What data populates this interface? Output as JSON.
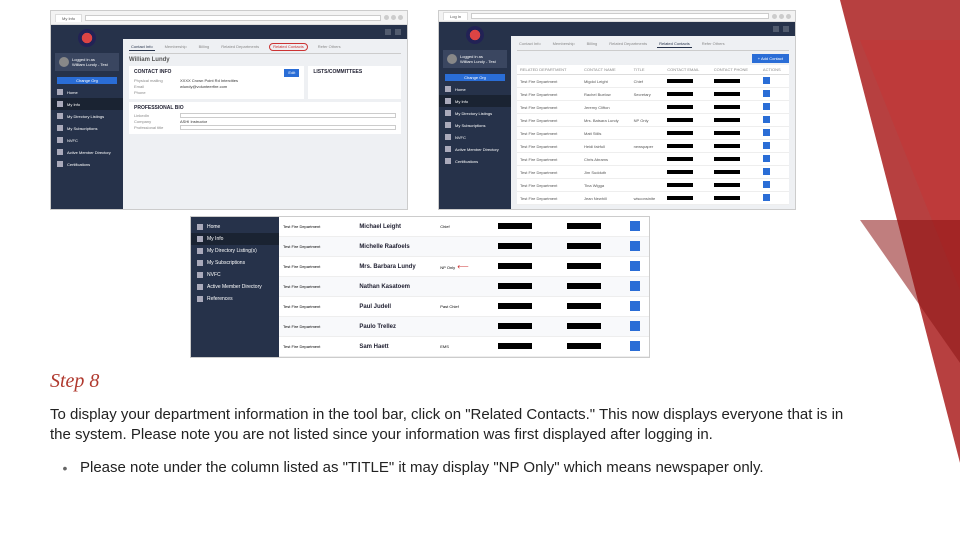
{
  "step_title": "Step 8",
  "step_text": "To display your department information in the tool bar, click on \"Related Contacts.\" This now displays everyone that is in the system.  Please note you are not listed since your information was first displayed after logging in.",
  "bullet_text": "Please note under the column listed as \"TITLE\" it may display \"NP Only\" which means newspaper only.",
  "shot1": {
    "browser_tab": "My Info",
    "name_heading": "William Lundy",
    "tabs": [
      "Contact Info",
      "Membership",
      "Billing",
      "Related Departments",
      "Related Contacts",
      "Refer Others"
    ],
    "active_tab": "Contact Info",
    "circled_tab": "Related Contacts",
    "card1_title": "CONTACT INFO",
    "card1_rows": [
      {
        "label": "Physical mailing",
        "value": "XXXX Crown Point Rd Intercities"
      },
      {
        "label": "Email",
        "value": "wlundy@volunteerfire.com"
      },
      {
        "label": "Phone",
        "value": ""
      }
    ],
    "edit_label": "Edit",
    "card1b_title": "LISTS/COMMITTEES",
    "card2_title": "PROFESSIONAL BIO",
    "card2_rows": [
      {
        "label": "LinkedIn",
        "value": ""
      },
      {
        "label": "Company",
        "value": "ASHI Instructor"
      },
      {
        "label": "Professional title",
        "value": ""
      }
    ],
    "sidebar": {
      "user_line1": "Logged in as",
      "user_line2": "William Lundy - Test",
      "change_org": "Change Org",
      "items": [
        "Home",
        "My Info",
        "My Directory Listings",
        "My Subscriptions",
        "NVFC",
        "Active Member Directory",
        "Certifications"
      ],
      "active": "My Info"
    }
  },
  "shot2": {
    "browser_tab": "Log In",
    "sidebar": {
      "user_line1": "Logged in as",
      "user_line2": "William Lundy - Test",
      "change_org": "Change Org",
      "items": [
        "Home",
        "My Info",
        "My Directory Listings",
        "My Subscriptions",
        "NVFC",
        "Active Member Directory",
        "Certifications"
      ],
      "active": "My Info"
    },
    "tabs": [
      "Contact Info",
      "Membership",
      "Billing",
      "Related Departments",
      "Related Contacts",
      "Refer Others"
    ],
    "active_tab": "Related Contacts",
    "add_btn": "+ Add Contact",
    "columns": [
      "RELATED DEPARTMENT",
      "CONTACT NAME",
      "TITLE",
      "CONTACT EMAIL",
      "CONTACT PHONE",
      "ACTIONS"
    ],
    "rows": [
      {
        "dept": "Test Fire Department",
        "name": "Migdol Leight",
        "title": "Chief"
      },
      {
        "dept": "Test Fire Department",
        "name": "Rachel Buelow",
        "title": "Secretary"
      },
      {
        "dept": "Test Fire Department",
        "name": "Jeremy Clifton",
        "title": ""
      },
      {
        "dept": "Test Fire Department",
        "name": "Mrs. Batsara Lundy",
        "title": "NP Only"
      },
      {
        "dept": "Test Fire Department",
        "name": "Matt Stills",
        "title": ""
      },
      {
        "dept": "Test Fire Department",
        "name": "Heidi fairfull",
        "title": "newspaper"
      },
      {
        "dept": "Test Fire Department",
        "name": "Chris Abrams",
        "title": ""
      },
      {
        "dept": "Test Fire Department",
        "name": "Jim Sudduth",
        "title": ""
      },
      {
        "dept": "Test Fire Department",
        "name": "Tina Wigga",
        "title": ""
      },
      {
        "dept": "Test Fire Department",
        "name": "Jean Newhill",
        "title": "wisconsinite"
      }
    ]
  },
  "shot3": {
    "sidebar_items": [
      "Home",
      "My Info",
      "My Directory Listing(s)",
      "My Subscriptions",
      "NVFC",
      "Active Member Directory",
      "References"
    ],
    "active": "My Info",
    "rows": [
      {
        "dept": "Test Fire Department",
        "name": "Michael Leight",
        "title": "Chief",
        "email": "",
        "phone": ""
      },
      {
        "dept": "Test Fire Department",
        "name": "Michelle Raafoels",
        "title": "",
        "email": "",
        "phone": ""
      },
      {
        "dept": "Test Fire Department",
        "name": "Mrs. Barbara Lundy",
        "title": "NP Only",
        "email": "",
        "phone": "",
        "arrow": true
      },
      {
        "dept": "Test Fire Department",
        "name": "Nathan Kasatoem",
        "title": "",
        "email": "",
        "phone": ""
      },
      {
        "dept": "Test Fire Department",
        "name": "Paul Judell",
        "title": "Past Chief",
        "email": "",
        "phone": ""
      },
      {
        "dept": "Test Fire Department",
        "name": "Paulo Trellez",
        "title": "",
        "email": "",
        "phone": ""
      },
      {
        "dept": "Test Fire Department",
        "name": "Sam Haett",
        "title": "EMS",
        "email": "",
        "phone": ""
      }
    ]
  }
}
